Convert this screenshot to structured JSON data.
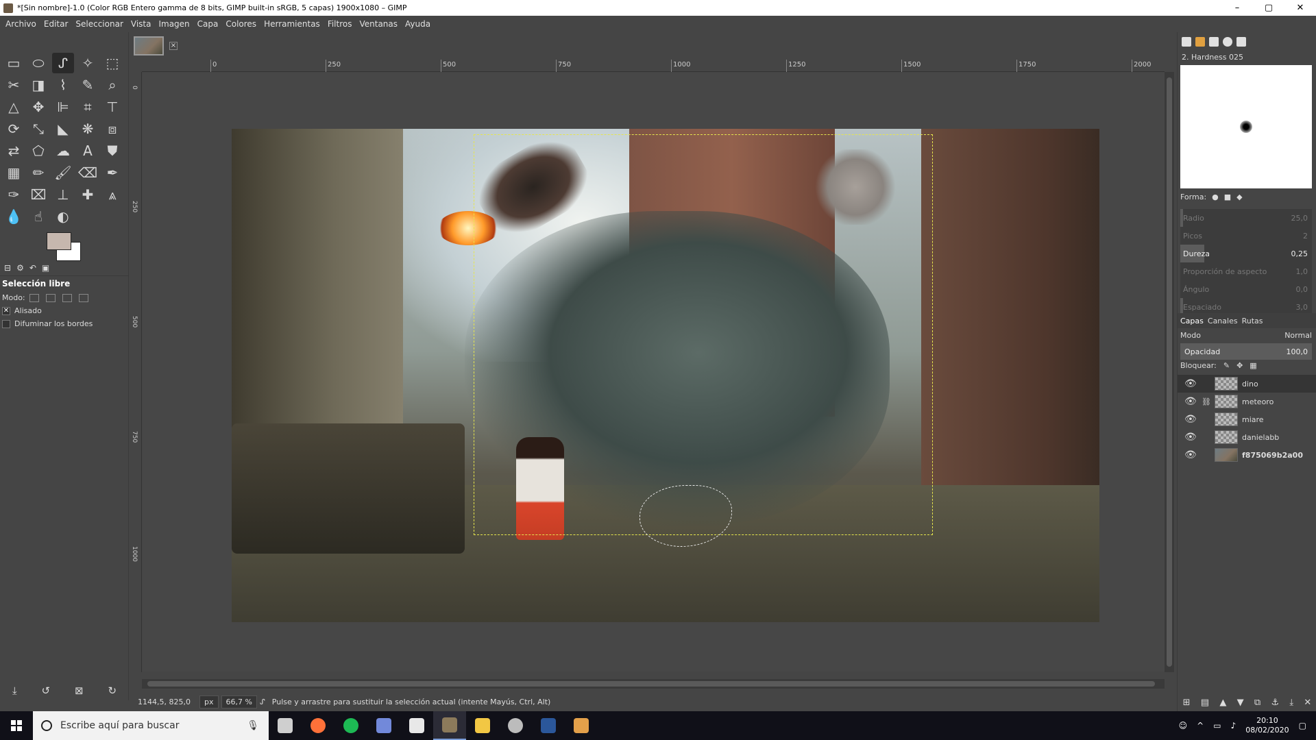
{
  "window": {
    "title": "*[Sin nombre]-1.0 (Color RGB Entero gamma de 8 bits, GIMP built-in sRGB, 5 capas) 1900x1080 – GIMP",
    "minimize": "–",
    "maximize": "▢",
    "close": "✕"
  },
  "menu": [
    "Archivo",
    "Editar",
    "Seleccionar",
    "Vista",
    "Imagen",
    "Capa",
    "Colores",
    "Herramientas",
    "Filtros",
    "Ventanas",
    "Ayuda"
  ],
  "tool_options": {
    "title": "Selección libre",
    "mode_label": "Modo:",
    "antialias_label": "Alisado",
    "antialias_checked": true,
    "feather_label": "Difuminar los bordes",
    "feather_checked": false
  },
  "rulers": {
    "h_ticks": [
      "0",
      "250",
      "500",
      "750",
      "1000",
      "1250",
      "1500",
      "1750",
      "2000"
    ],
    "v_ticks": [
      "0",
      "250",
      "500",
      "750",
      "1000"
    ]
  },
  "status": {
    "coords": "1144,5, 825,0",
    "unit": "px",
    "zoom": "66,7 %",
    "message": "Pulse y arrastre para sustituir la selección actual (intente Mayús, Ctrl, Alt)"
  },
  "brushes": {
    "name": "2. Hardness 025",
    "forma_label": "Forma:",
    "sliders": [
      {
        "label": "Radio",
        "value": "25,0",
        "fill": 0.02,
        "active": false
      },
      {
        "label": "Picos",
        "value": "2",
        "fill": 0.0,
        "active": false
      },
      {
        "label": "Dureza",
        "value": "0,25",
        "fill": 0.18,
        "active": true
      },
      {
        "label": "Proporción de aspecto",
        "value": "1,0",
        "fill": 0.0,
        "active": false
      },
      {
        "label": "Ángulo",
        "value": "0,0",
        "fill": 0.0,
        "active": false
      },
      {
        "label": "Espaciado",
        "value": "3,0",
        "fill": 0.02,
        "active": false
      }
    ]
  },
  "layers_panel": {
    "tabs": [
      "Capas",
      "Canales",
      "Rutas"
    ],
    "mode_label": "Modo",
    "mode_value": "Normal",
    "opacity_label": "Opacidad",
    "opacity_value": "100,0",
    "lock_label": "Bloquear:",
    "layers": [
      {
        "name": "dino",
        "selected": true,
        "linked": false,
        "photo": false
      },
      {
        "name": "meteoro",
        "selected": false,
        "linked": true,
        "photo": false
      },
      {
        "name": "miare",
        "selected": false,
        "linked": false,
        "photo": false
      },
      {
        "name": "danielabb",
        "selected": false,
        "linked": false,
        "photo": false
      },
      {
        "name": "f875069b2a00",
        "selected": false,
        "linked": false,
        "photo": true
      }
    ]
  },
  "taskbar": {
    "search_placeholder": "Escribe aquí para buscar",
    "time": "20:10",
    "date": "08/02/2020",
    "apps": [
      {
        "name": "task-view",
        "color": "#cfcfcf"
      },
      {
        "name": "firefox",
        "color": "#ff7139"
      },
      {
        "name": "spotify",
        "color": "#1db954"
      },
      {
        "name": "discord",
        "color": "#7289da"
      },
      {
        "name": "photos",
        "color": "#e8e8e8"
      },
      {
        "name": "gimp",
        "color": "#8c7a5b"
      },
      {
        "name": "file-explorer",
        "color": "#f2c744"
      },
      {
        "name": "obs",
        "color": "#bcbcbc"
      },
      {
        "name": "word",
        "color": "#2b579a"
      },
      {
        "name": "paint",
        "color": "#e3a04a"
      }
    ]
  },
  "colors": {
    "foreground": "#c6b7ae",
    "background": "#ffffff"
  }
}
